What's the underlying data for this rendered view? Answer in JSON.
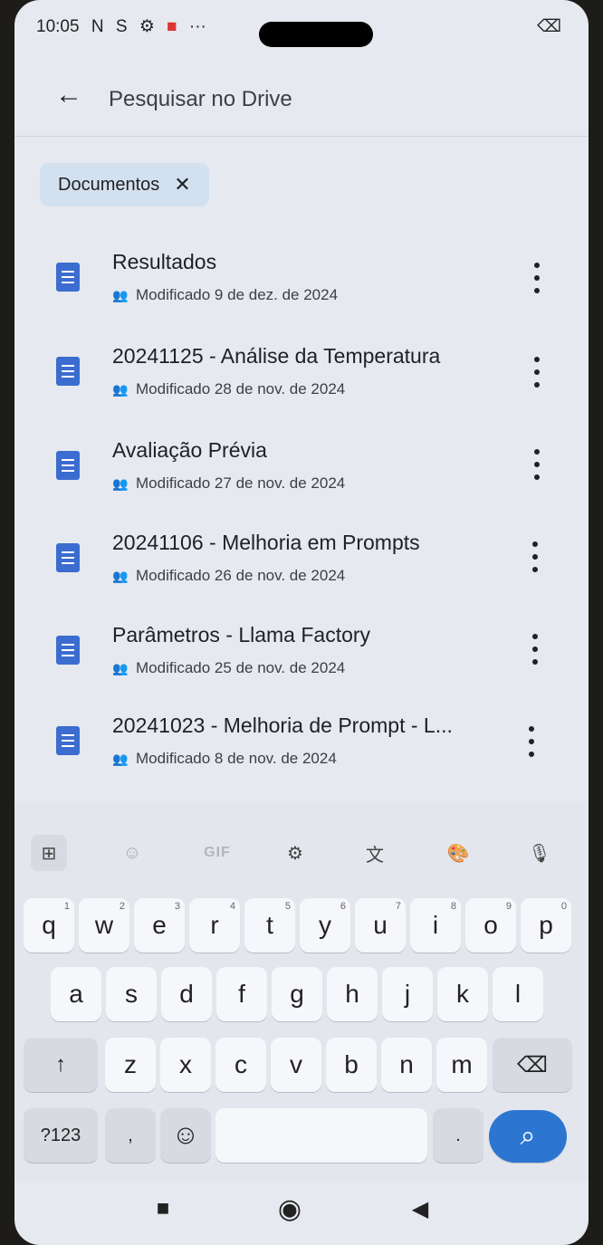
{
  "status": {
    "time": "10:05",
    "icons_left": [
      "N",
      "S",
      "⚙",
      "■",
      "···"
    ],
    "icons_right": [
      "⌫"
    ]
  },
  "search": {
    "back_icon": "arrow-left-icon",
    "placeholder": "Pesquisar no Drive"
  },
  "filter_chip": {
    "label": "Documentos",
    "close": "✕"
  },
  "documents": [
    {
      "title": "Resultados",
      "modified": "Modificado 9 de dez. de 2024"
    },
    {
      "title": "20241125 -  Análise da Temperatura",
      "modified": "Modificado 28 de nov. de 2024"
    },
    {
      "title": "Avaliação Prévia",
      "modified": "Modificado 27 de nov. de 2024"
    },
    {
      "title": "20241106 - Melhoria em Prompts",
      "modified": "Modificado 26 de nov. de 2024"
    },
    {
      "title": "Parâmetros - Llama Factory",
      "modified": "Modificado 25 de nov. de 2024"
    },
    {
      "title": "20241023 - Melhoria de Prompt - L...",
      "modified": "Modificado 8 de nov. de 2024"
    }
  ],
  "keyboard_tools": {
    "gif_label": "GIF"
  },
  "keyboard": {
    "row1": [
      {
        "k": "q",
        "n": "1"
      },
      {
        "k": "w",
        "n": "2"
      },
      {
        "k": "e",
        "n": "3"
      },
      {
        "k": "r",
        "n": "4"
      },
      {
        "k": "t",
        "n": "5"
      },
      {
        "k": "y",
        "n": "6"
      },
      {
        "k": "u",
        "n": "7"
      },
      {
        "k": "i",
        "n": "8"
      },
      {
        "k": "o",
        "n": "9"
      },
      {
        "k": "p",
        "n": "0"
      }
    ],
    "row2": [
      "a",
      "s",
      "d",
      "f",
      "g",
      "h",
      "j",
      "k",
      "l"
    ],
    "row3": [
      "z",
      "x",
      "c",
      "v",
      "b",
      "n",
      "m"
    ],
    "shift": "↑",
    "backspace": "⌫",
    "sym": "?123",
    "comma": ",",
    "emoji": "☺",
    "period": ".",
    "search": "⌕"
  },
  "nav": {
    "recents": "■",
    "home": "◉",
    "back": "◀"
  }
}
